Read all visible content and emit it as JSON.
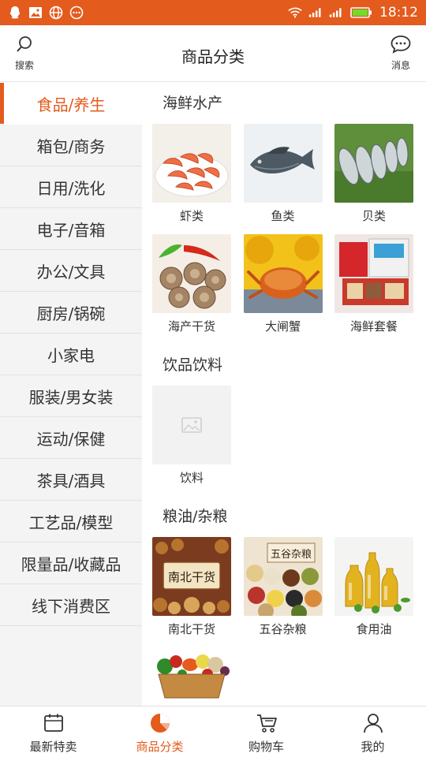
{
  "status_bar": {
    "time": "18:12",
    "icons": [
      "qq-icon",
      "image-icon",
      "globe-icon",
      "more-icon",
      "wifi-icon",
      "signal-icon",
      "signal-icon",
      "battery-icon"
    ]
  },
  "header": {
    "title": "商品分类",
    "search_label": "搜索",
    "message_label": "消息"
  },
  "sidebar": {
    "items": [
      {
        "label": "食品/养生",
        "active": true
      },
      {
        "label": "箱包/商务"
      },
      {
        "label": "日用/洗化"
      },
      {
        "label": "电子/音箱"
      },
      {
        "label": "办公/文具"
      },
      {
        "label": "厨房/锅碗"
      },
      {
        "label": "小家电"
      },
      {
        "label": "服装/男女装"
      },
      {
        "label": "运动/保健"
      },
      {
        "label": "茶具/酒具"
      },
      {
        "label": "工艺品/模型"
      },
      {
        "label": "限量品/收藏品"
      },
      {
        "label": "线下消费区"
      }
    ]
  },
  "sections": [
    {
      "title": "海鲜水产",
      "items": [
        {
          "label": "虾类"
        },
        {
          "label": "鱼类"
        },
        {
          "label": "贝类"
        },
        {
          "label": "海产干货"
        },
        {
          "label": "大闸蟹"
        },
        {
          "label": "海鲜套餐"
        }
      ]
    },
    {
      "title": "饮品饮料",
      "items": [
        {
          "label": "饮料"
        }
      ]
    },
    {
      "title": "粮油/杂粮",
      "items": [
        {
          "label": "南北干货",
          "image_text": "南北干货"
        },
        {
          "label": "五谷杂粮",
          "image_text": "五谷杂粮"
        },
        {
          "label": "食用油"
        },
        {
          "label": ""
        }
      ]
    }
  ],
  "tabs": [
    {
      "label": "最新特卖",
      "icon": "calendar-icon"
    },
    {
      "label": "商品分类",
      "icon": "category-icon",
      "active": true
    },
    {
      "label": "购物车",
      "icon": "cart-icon"
    },
    {
      "label": "我的",
      "icon": "user-icon"
    }
  ],
  "colors": {
    "accent": "#e35b1d",
    "sidebar_bg": "#f4f4f4",
    "divider": "#e2e2e2"
  }
}
